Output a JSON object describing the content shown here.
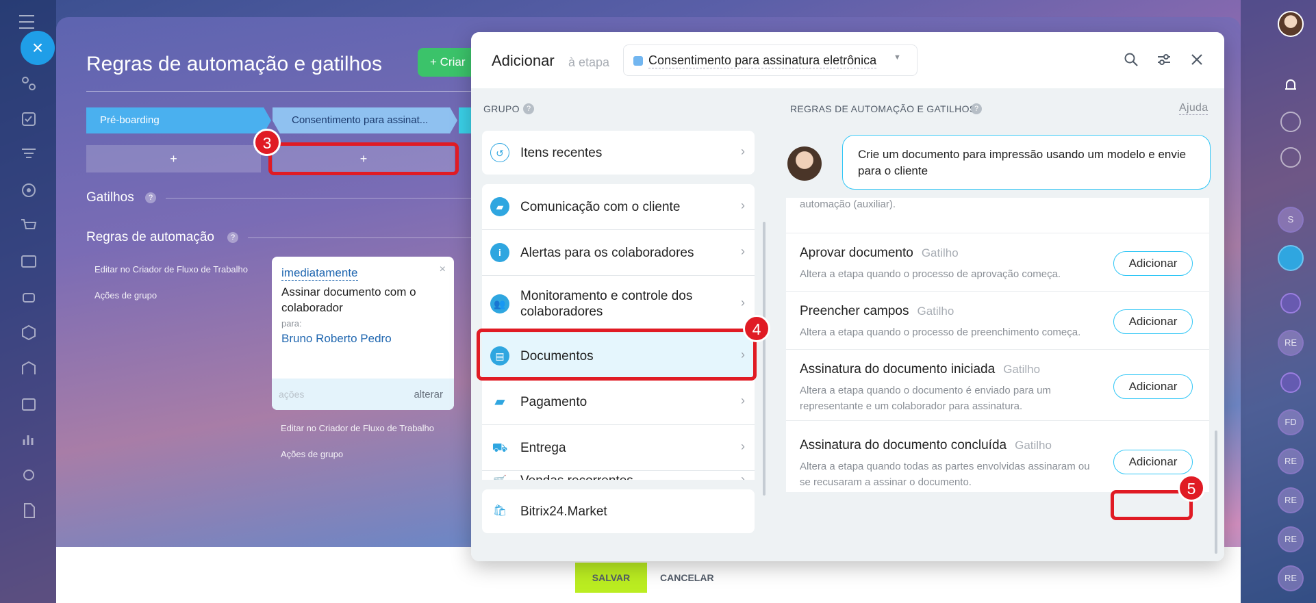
{
  "main": {
    "title": "Regras de automação e gatilhos",
    "create_label": "+ Criar",
    "stages": [
      "Pré-boarding",
      "Consentimento para assinat..."
    ],
    "add_plus": "+",
    "triggers_label": "Gatilhos",
    "rules_label": "Regras de automação",
    "col1_links": [
      "Editar no Criador de Fluxo de Trabalho",
      "Ações de grupo"
    ],
    "col2_links": [
      "Editar no Criador de Fluxo de Trabalho",
      "Ações de grupo"
    ],
    "rule_card": {
      "when": "imediatamente",
      "name": "Assinar documento com o colaborador",
      "to_label": "para:",
      "to_value": "Bruno Roberto Pedro",
      "actions": "ações",
      "change": "alterar"
    },
    "save_label": "SALVAR",
    "cancel_label": "CANCELAR"
  },
  "modal": {
    "title": "Adicionar",
    "subtitle": "à etapa",
    "stage": "Consentimento para assinatura eletrônica",
    "group_heading": "GRUPO",
    "groups": [
      {
        "label": "Itens recentes",
        "icon": "history-icon"
      },
      {
        "label": "Comunicação com o cliente",
        "icon": "chat-icon"
      },
      {
        "label": "Alertas para os colaboradores",
        "icon": "info-icon"
      },
      {
        "label": "Monitoramento e controle dos colaboradores",
        "icon": "users-icon"
      },
      {
        "label": "Documentos",
        "icon": "document-icon"
      },
      {
        "label": "Pagamento",
        "icon": "wallet-icon"
      },
      {
        "label": "Entrega",
        "icon": "truck-icon"
      },
      {
        "label": "Vendas recorrentes",
        "icon": "cart-icon"
      },
      {
        "label": "Bitrix24.Market",
        "icon": "market-icon"
      }
    ],
    "rules_heading": "REGRAS DE AUTOMAÇÃO E GATILHOS",
    "help_link": "Ajuda",
    "hint": "Crie um documento para impressão usando um modelo e envie para o cliente",
    "cut_text": "automação (auxiliar).",
    "triggers": [
      {
        "name": "Aprovar documento",
        "tag": "Gatilho",
        "desc": "Altera a etapa quando o processo de aprovação começa.",
        "button": "Adicionar"
      },
      {
        "name": "Preencher campos",
        "tag": "Gatilho",
        "desc": "Altera a etapa quando o processo de preenchimento começa.",
        "button": "Adicionar"
      },
      {
        "name": "Assinatura do documento iniciada",
        "tag": "Gatilho",
        "desc": "Altera a etapa quando o documento é enviado para um representante e um colaborador para assinatura.",
        "button": "Adicionar"
      },
      {
        "name": "Assinatura do documento concluída",
        "tag": "Gatilho",
        "desc": "Altera a etapa quando todas as partes envolvidas assinaram ou se recusaram a assinar o documento.",
        "button": "Adicionar"
      }
    ]
  },
  "rail_letters": [
    "S",
    "RE",
    "FD",
    "RE",
    "RE",
    "RE",
    "RE"
  ],
  "callouts": [
    "3",
    "4",
    "5"
  ],
  "colors": {
    "accent": "#2fc6f6",
    "callout": "#e01b24",
    "save": "#bbed21",
    "create": "#3bc36a"
  }
}
